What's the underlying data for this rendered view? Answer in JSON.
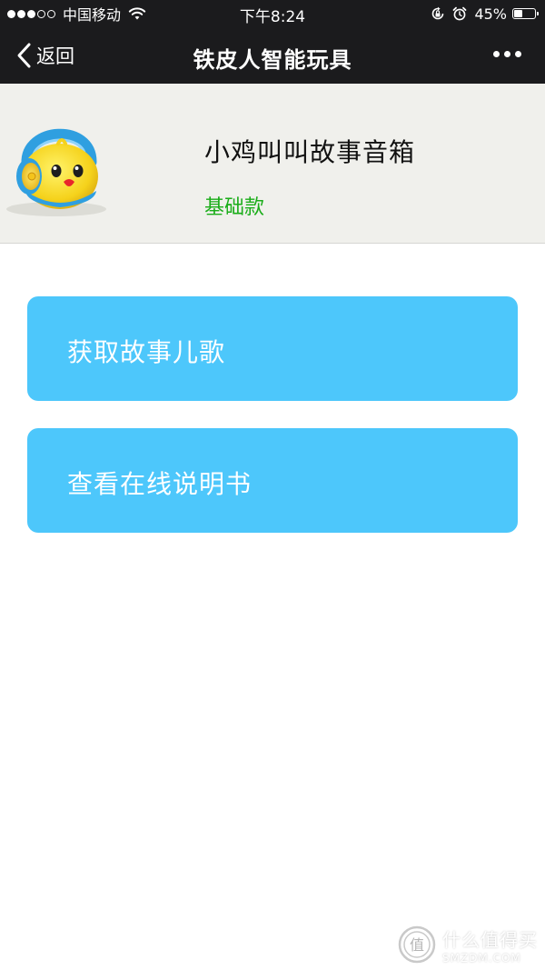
{
  "status_bar": {
    "carrier": "中国移动",
    "time": "下午8:24",
    "battery_percent": "45%",
    "battery_level": 0.45,
    "signal_bars_filled": 3,
    "signal_bars_total": 5,
    "icons": [
      "wifi-icon",
      "rotation-lock-icon",
      "alarm-icon",
      "battery-icon"
    ]
  },
  "nav": {
    "back_label": "返回",
    "title": "铁皮人智能玩具",
    "icons": [
      "chevron-left-icon",
      "more-icon"
    ]
  },
  "product": {
    "name": "小鸡叫叫故事音箱",
    "model": "基础款",
    "model_color": "#1aad19"
  },
  "actions": [
    {
      "label": "获取故事儿歌"
    },
    {
      "label": "查看在线说明书"
    }
  ],
  "colors": {
    "navbar_bg": "#1b1b1d",
    "button_bg": "#4dc7fb",
    "header_bg": "#f0f0ec"
  },
  "watermark": {
    "text_cn": "什么值得买",
    "text_en": "SMZDM.COM"
  }
}
